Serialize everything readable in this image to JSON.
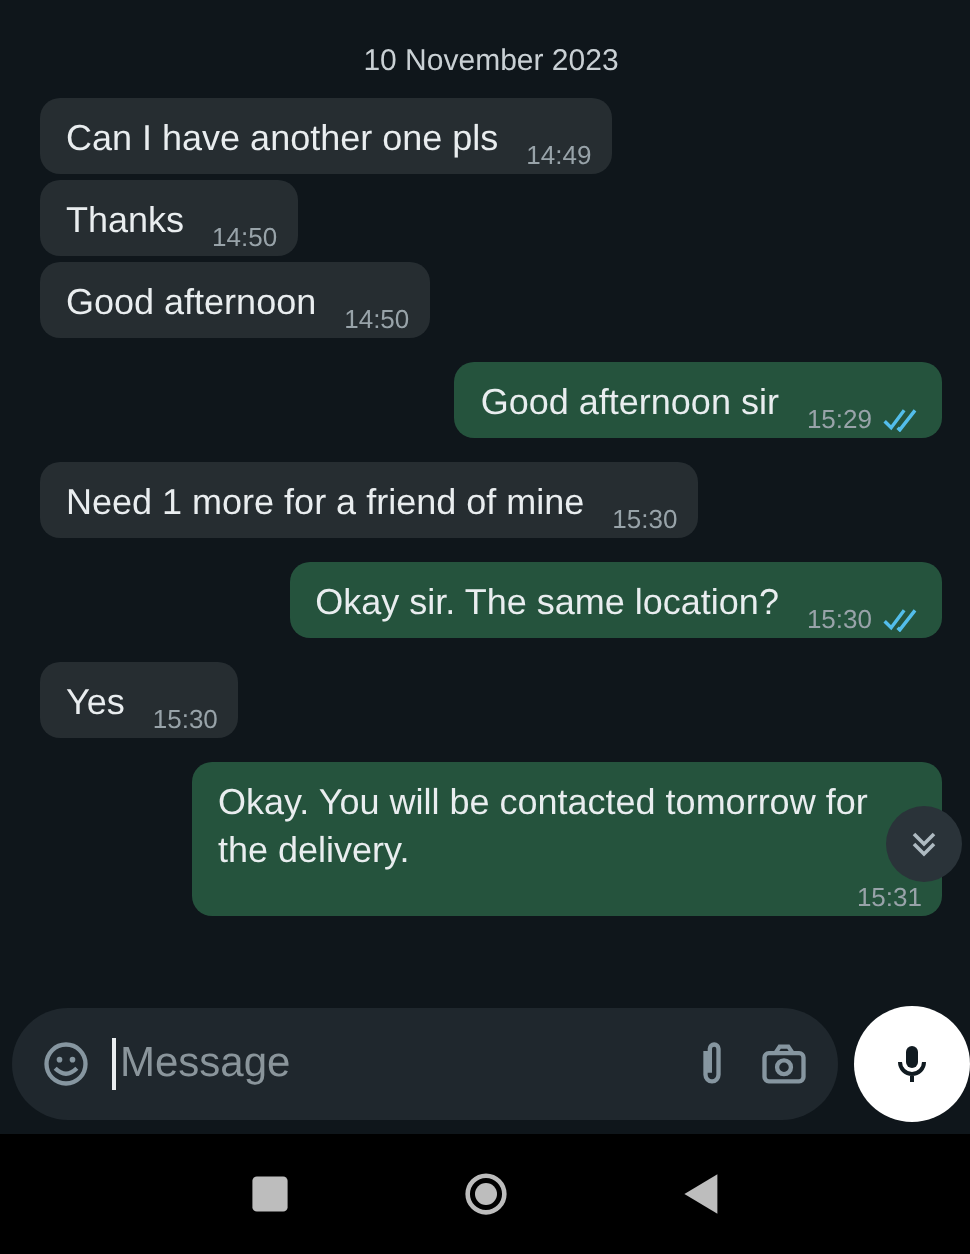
{
  "date_chip": "10 November 2023",
  "messages": [
    {
      "kind": "in",
      "text": "Can I have another one pls",
      "time": "14:49"
    },
    {
      "kind": "in",
      "text": "Thanks",
      "time": "14:50"
    },
    {
      "kind": "in",
      "text": "Good afternoon",
      "time": "14:50"
    },
    {
      "kind": "out",
      "text": "Good afternoon sir",
      "time": "15:29",
      "read": true
    },
    {
      "kind": "in",
      "text": "Need 1 more for a friend of mine",
      "time": "15:30"
    },
    {
      "kind": "out",
      "text": "Okay sir. The same location?",
      "time": "15:30",
      "read": true
    },
    {
      "kind": "in",
      "text": "Yes",
      "time": "15:30"
    },
    {
      "kind": "out",
      "text": "Okay. You will be contacted tomorrow for the delivery.",
      "time": "15:31"
    }
  ],
  "composer": {
    "placeholder": "Message"
  }
}
